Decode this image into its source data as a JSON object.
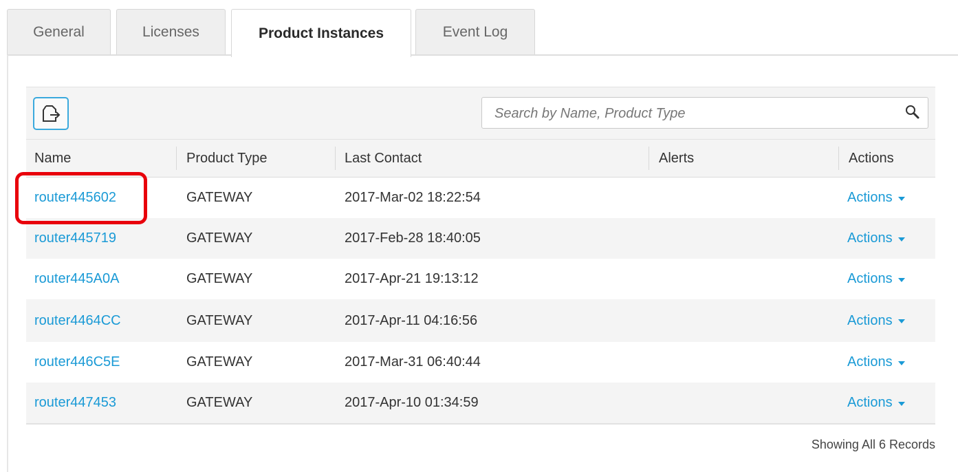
{
  "tabs": [
    {
      "label": "General",
      "active": false
    },
    {
      "label": "Licenses",
      "active": false
    },
    {
      "label": "Product Instances",
      "active": true
    },
    {
      "label": "Event Log",
      "active": false
    }
  ],
  "toolbar": {
    "export_icon": "export-icon",
    "search_placeholder": "Search by Name, Product Type",
    "search_icon": "search-icon"
  },
  "table": {
    "headers": [
      "Name",
      "Product Type",
      "Last Contact",
      "Alerts",
      "Actions"
    ],
    "rows": [
      {
        "name": "router445602",
        "product_type": "GATEWAY",
        "last_contact": "2017-Mar-02 18:22:54",
        "alerts": "",
        "actions": "Actions"
      },
      {
        "name": "router445719",
        "product_type": "GATEWAY",
        "last_contact": "2017-Feb-28 18:40:05",
        "alerts": "",
        "actions": "Actions"
      },
      {
        "name": "router445A0A",
        "product_type": "GATEWAY",
        "last_contact": "2017-Apr-21 19:13:12",
        "alerts": "",
        "actions": "Actions"
      },
      {
        "name": "router4464CC",
        "product_type": "GATEWAY",
        "last_contact": "2017-Apr-11 04:16:56",
        "alerts": "",
        "actions": "Actions"
      },
      {
        "name": "router446C5E",
        "product_type": "GATEWAY",
        "last_contact": "2017-Mar-31 06:40:44",
        "alerts": "",
        "actions": "Actions"
      },
      {
        "name": "router447453",
        "product_type": "GATEWAY",
        "last_contact": "2017-Apr-10 01:34:59",
        "alerts": "",
        "actions": "Actions"
      }
    ],
    "footer": "Showing All 6 Records"
  },
  "colors": {
    "link": "#1a9ad6",
    "highlight": "#e8000b",
    "export_border": "#3aa9dd"
  }
}
